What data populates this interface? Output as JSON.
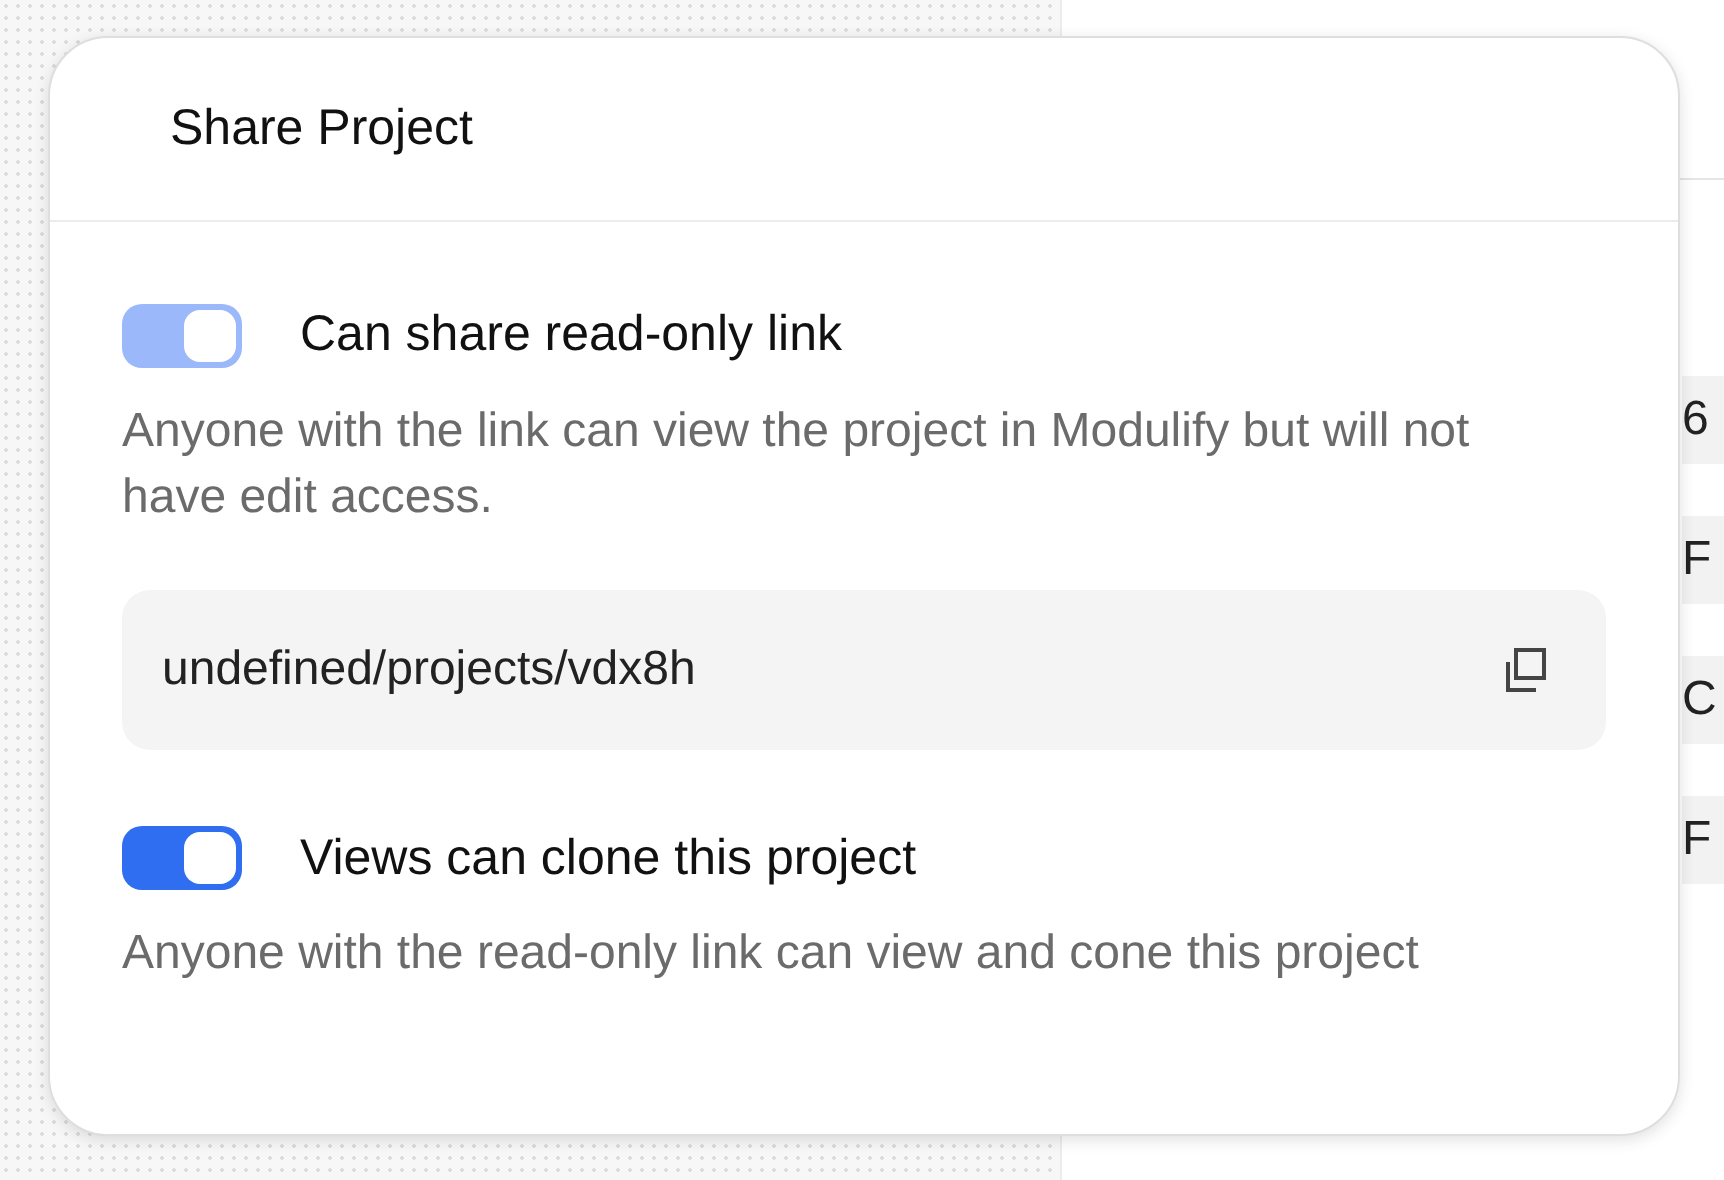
{
  "background_rows": [
    {
      "text": "6"
    },
    {
      "text": "F"
    },
    {
      "text": "C"
    },
    {
      "text": "F"
    }
  ],
  "dialog": {
    "title": "Share Project",
    "options": [
      {
        "label": "Can share read-only link",
        "on": true,
        "disabled": true,
        "description": "Anyone with the link can view the project in Modulify but will not have edit access.",
        "link": "undefined/projects/vdx8h"
      },
      {
        "label": "Views can clone this project",
        "on": true,
        "disabled": false,
        "description": "Anyone with the read-only link can view and cone this project"
      }
    ]
  }
}
